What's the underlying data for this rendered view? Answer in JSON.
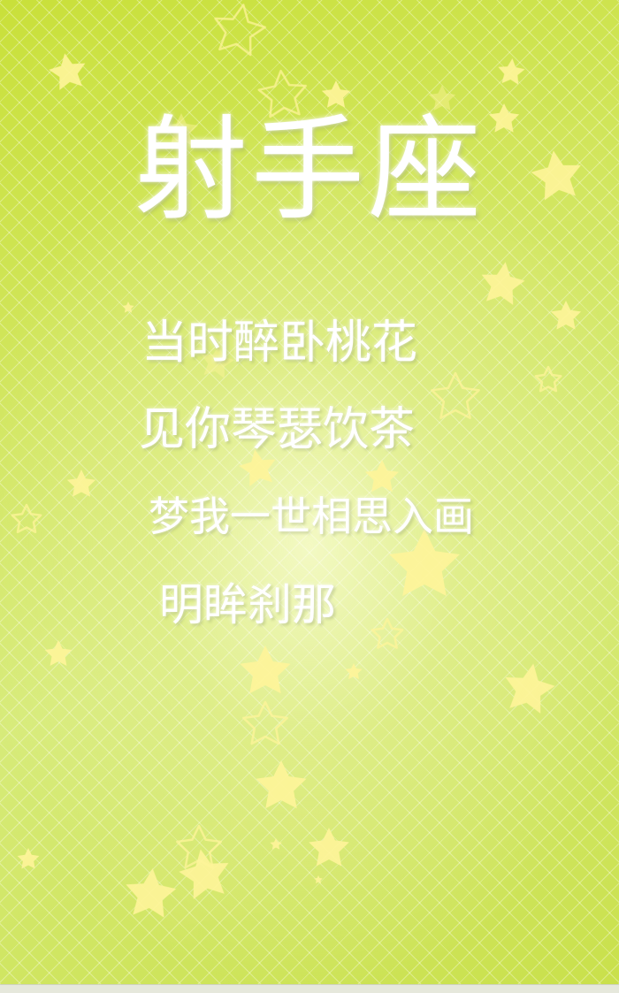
{
  "title": "射手座",
  "poem": {
    "lines": [
      "当时醉卧桃花",
      "见你琴瑟饮茶",
      "梦我一世相思入画",
      "明眸刹那"
    ]
  },
  "colors": {
    "background_green": "#c9e03a",
    "center_glow": "#f5fac8",
    "text": "#ffffff",
    "star_fill": "#fff59a"
  },
  "icons": [
    "star-icon"
  ]
}
